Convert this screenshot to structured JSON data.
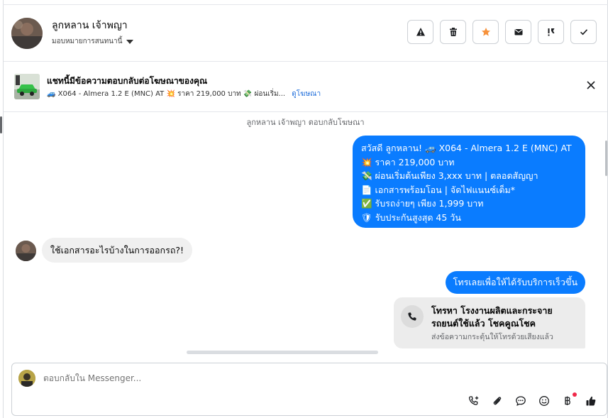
{
  "header": {
    "name": "ลูกหลาน เจ้าพญา",
    "assign_label": "มอบหมายการสนทนานี้",
    "actions": [
      {
        "icon": "warning-icon"
      },
      {
        "icon": "trash-icon"
      },
      {
        "icon": "star-icon"
      },
      {
        "icon": "mail-icon"
      },
      {
        "icon": "mark-important-icon"
      },
      {
        "icon": "checkmark-icon"
      }
    ]
  },
  "ad_banner": {
    "title": "แชทนี้มีข้อความตอบกลับต่อโฆษณาของคุณ",
    "detail": "🚙 X064 - Almera 1.2 E (MNC) AT 💥 ราคา 219,000 บาท 💸 ผ่อนเริ่ม...",
    "link": "ดูโฆษณา"
  },
  "chat": {
    "system_note": "ลูกหลาน เจ้าพญา ตอบกลับโฆษณา",
    "outgoing_1": {
      "lines": [
        "สวัสดี ลูกหลาน! 🚙 X064 - Almera 1.2 E (MNC) AT",
        "💥 ราคา 219,000 บาท",
        "💸 ผ่อนเริ่มต้นเพียง 3,xxx บาท | ตลอดสัญญา",
        "📄 เอกสารพร้อมโอน | จัดไฟแนนซ์เต็ม*",
        "✅ รับรถง่ายๆ เพียง 1,999 บาท",
        "🛡 รับประกันสูงสุด 45 วัน"
      ]
    },
    "incoming_1": "ใช้เอกสารอะไรบ้างในการออกรถ?!",
    "outgoing_2": "โทรเลยเพื่อให้ได้รับบริการเร็วขึ้น",
    "call_card": {
      "title": "โทรหา โรงงานผลิตและกระจายรถยนต์ใช้แล้ว โชคคูณโชค",
      "subtitle": "ส่งข้อความกระตุ้นให้โทรด้วยเสียงแล้ว"
    }
  },
  "composer": {
    "placeholder": "ตอบกลับใน Messenger...",
    "tools": [
      "add-call-icon",
      "attachment-icon",
      "saved-replies-icon",
      "emoji-icon",
      "baht-payment-icon",
      "thumbs-up-icon"
    ]
  },
  "colors": {
    "accent": "#0a7cff",
    "star": "#f7923b",
    "link": "#216fdb"
  }
}
